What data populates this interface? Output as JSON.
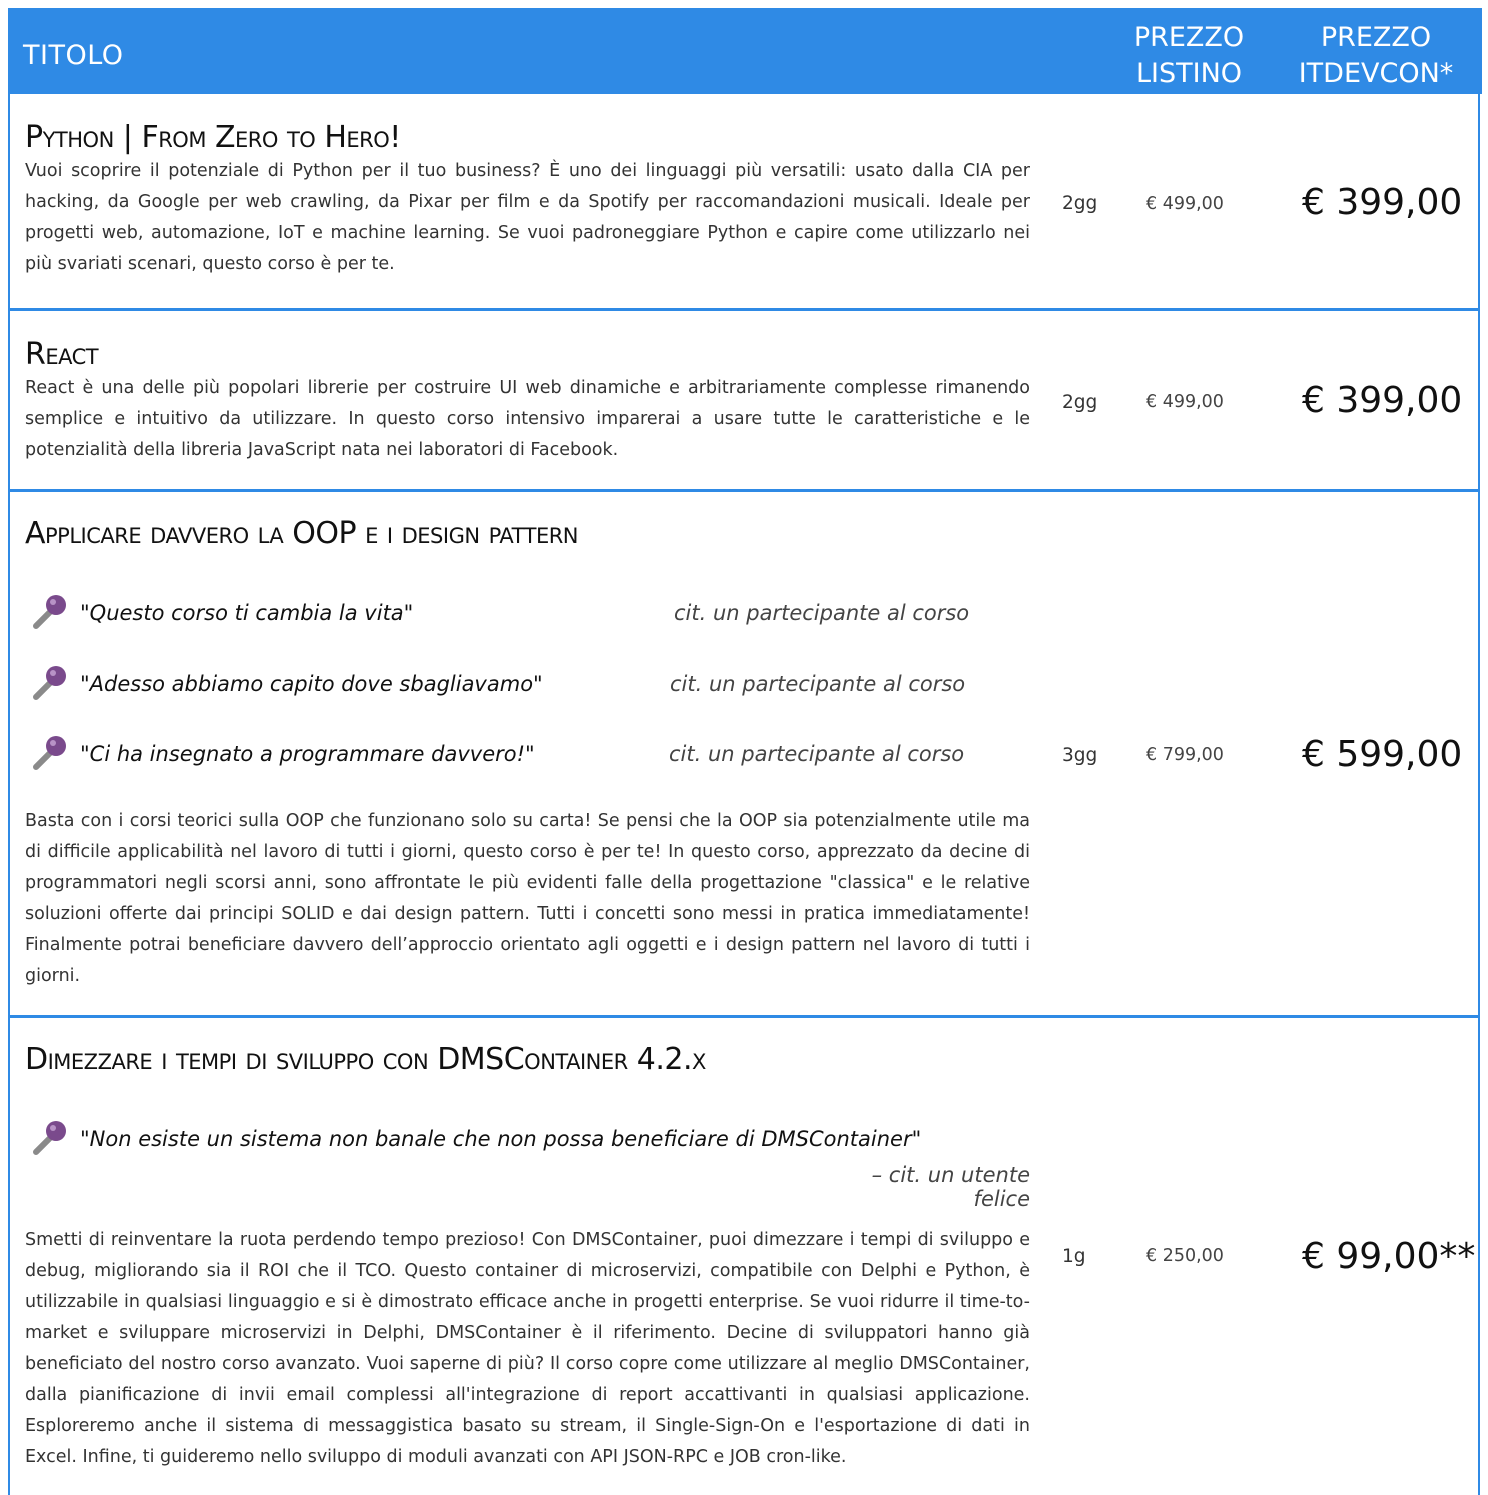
{
  "header": {
    "title": "TITOLO",
    "price_list": "PREZZO LISTINO",
    "price_itdevcon": "PREZZO ITDEVCON*"
  },
  "courses": [
    {
      "title": "Python | From Zero to Hero!",
      "description": "Vuoi scoprire il potenziale di Python per il tuo business? È uno dei linguaggi più versatili: usato dalla CIA per hacking, da Google per web crawling, da Pixar per film e da Spotify per raccomandazioni musicali. Ideale per progetti web, automazione, IoT e machine learning. Se vuoi padroneggiare Python e capire come utilizzarlo nei più svariati scenari, questo corso è per te.",
      "duration": "2gg",
      "list_price": "€ 499,00",
      "itdevcon_price": "€ 399,00"
    },
    {
      "title": "React",
      "description": "React è una delle più popolari librerie per costruire UI web dinamiche e arbitrariamente complesse rimanendo semplice e intuitivo da utilizzare. In questo corso intensivo imparerai a usare tutte le caratteristiche e le potenzialità della libreria JavaScript nata nei laboratori di Facebook.",
      "duration": "2gg",
      "list_price": "€ 499,00",
      "itdevcon_price": "€ 399,00"
    },
    {
      "title": "Applicare davvero la OOP e i design pattern",
      "quotes": [
        {
          "text": "\"Questo corso ti cambia la vita\"",
          "cite": "cit. un partecipante al corso"
        },
        {
          "text": "\"Adesso abbiamo capito dove sbagliavamo\"",
          "cite": "cit. un partecipante al corso"
        },
        {
          "text": "\"Ci ha insegnato a programmare davvero!\"",
          "cite": "cit. un partecipante al corso"
        }
      ],
      "description": "Basta con i corsi teorici sulla OOP che funzionano solo su carta! Se pensi che la OOP sia potenzialmente utile ma di difficile applicabilità nel lavoro di tutti i giorni, questo corso è per te! In questo corso, apprezzato da decine di programmatori negli scorsi anni, sono affrontate le più evidenti falle della progettazione \"classica\" e le relative soluzioni offerte dai principi SOLID e dai design pattern. Tutti i concetti sono messi in pratica immediatamente! Finalmente potrai beneficiare davvero dell’approccio orientato agli oggetti e i design pattern nel lavoro di tutti i giorni.",
      "duration": "3gg",
      "list_price": "€ 799,00",
      "itdevcon_price": "€ 599,00"
    },
    {
      "title": "Dimezzare i tempi di sviluppo con DMSContainer 4.2.x",
      "quote": {
        "text": "\"Non esiste un sistema non banale che non possa beneficiare di DMSContainer\"",
        "cite": "– cit. un utente felice"
      },
      "description": "Smetti di reinventare la ruota perdendo tempo prezioso! Con DMSContainer, puoi dimezzare i tempi di sviluppo e debug, migliorando sia il ROI che il TCO. Questo container di microservizi, compatibile con Delphi e Python, è utilizzabile in qualsiasi linguaggio e si è dimostrato efficace anche in progetti enterprise. Se vuoi ridurre il time-to-market e sviluppare microservizi in Delphi, DMSContainer è il riferimento. Decine di sviluppatori hanno già beneficiato del nostro corso avanzato. Vuoi saperne di più? Il corso copre come utilizzare al meglio DMSContainer, dalla pianificazione di invii email complessi all'integrazione di report accattivanti in qualsiasi applicazione. Esploreremo anche il sistema di messaggistica basato su stream, il Single-Sign-On e l'esportazione di dati in Excel. Infine, ti guideremo nello sviluppo di moduli avanzati con API JSON-RPC e JOB cron-like.",
      "duration": "1g",
      "list_price": "€ 250,00",
      "itdevcon_price": "€ 99,00**"
    }
  ],
  "colors": {
    "header_bg": "#2f8ae5",
    "mic": "#7a4a8c"
  },
  "icons": {
    "quote": "microphone-icon"
  }
}
